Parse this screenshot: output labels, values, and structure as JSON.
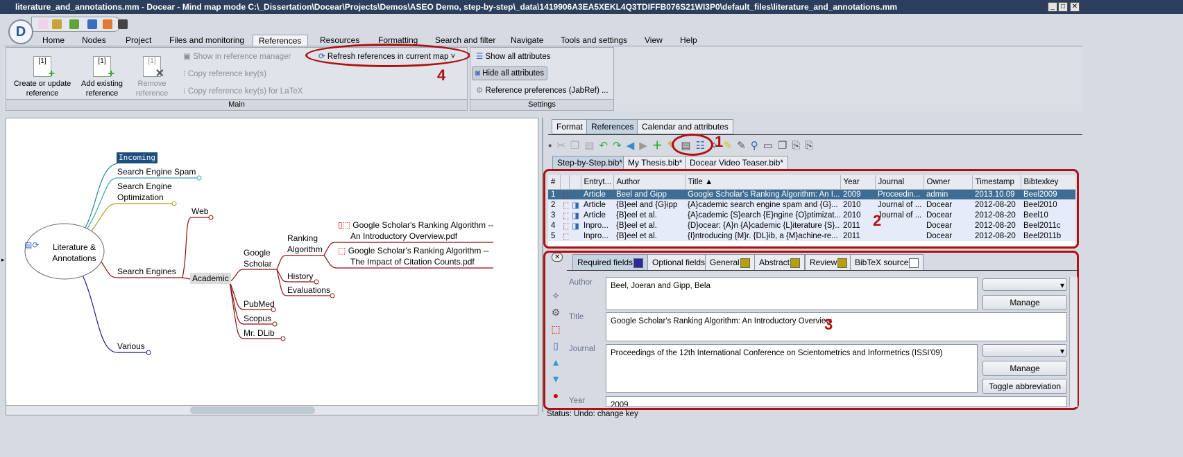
{
  "window": {
    "title": "literature_and_annotations.mm - Docear - Mind map mode C:\\_Dissertation\\Docear\\Projects\\Demos\\ASEO Demo, step-by-step\\_data\\1419906A3EA5XEKL4Q3TDIFFB076S21WI3P0\\default_files\\literature_and_annotations.mm",
    "controls": [
      "_",
      "□",
      "✕"
    ]
  },
  "menu": {
    "tabs": [
      "Home",
      "Nodes",
      "Project",
      "Files and monitoring",
      "References",
      "Resources",
      "Formatting",
      "Search and filter",
      "Navigate",
      "Tools and settings",
      "View",
      "Help"
    ],
    "active": "References"
  },
  "ribbon": {
    "main": {
      "label": "Main",
      "create": "Create or update reference",
      "add": "Add existing reference",
      "remove": "Remove reference",
      "show_in_manager": "Show in reference manager",
      "copy_keys": "Copy reference key(s)",
      "copy_keys_latex": "Copy reference key(s) for LaTeX",
      "refresh": "Refresh references in current map",
      "icon_text": "[1]"
    },
    "settings": {
      "label": "Settings",
      "show_all": "Show all attributes",
      "hide_all": "Hide all attributes",
      "prefs": "Reference preferences (JabRef) ..."
    }
  },
  "annotations": {
    "one": "1",
    "two": "2",
    "three": "3",
    "four": "4",
    "color": "#b01010"
  },
  "mindmap": {
    "root": "Literature & Annotations",
    "nodes": {
      "incoming": "Incoming",
      "spam": "Search Engine Spam",
      "seo1": "Search Engine",
      "seo2": "Optimization",
      "search_engines": "Search Engines",
      "web": "Web",
      "academic": "Academic",
      "gs1": "Google",
      "gs2": "Scholar",
      "ra1": "Ranking",
      "ra2": "Algorithm",
      "history": "History",
      "evaluations": "Evaluations",
      "pubmed": "PubMed",
      "scopus": "Scopus",
      "mrdlib": "Mr. DLib",
      "various": "Various",
      "pdf1a": "Google Scholar's Ranking Algorithm --",
      "pdf1b": "An Introductory Overview.pdf",
      "pdf2a": "Google Scholar's Ranking Algorithm --",
      "pdf2b": "The Impact of Citation Counts.pdf"
    }
  },
  "panel": {
    "tabs": [
      "Format",
      "References",
      "Calendar and attributes"
    ],
    "active_tab": "References",
    "bib_tabs": [
      "Step-by-Step.bib*",
      "My Thesis.bib*",
      "Docear Video Teaser.bib*"
    ],
    "table": {
      "columns": [
        "#",
        "",
        "",
        "Entryt...",
        "Author",
        "Title ▲",
        "Year",
        "Journal",
        "Owner",
        "Timestamp",
        "Bibtexkey"
      ],
      "rows": [
        [
          "1",
          "Article",
          "Beel and Gipp",
          "Google Scholar's Ranking Algorithm: An I...",
          "2009",
          "Proceedin...",
          "admin",
          "2013.10.09",
          "Beel2009"
        ],
        [
          "2",
          "Article",
          "{B}eel and {G}ipp",
          "{A}cademic search engine spam and {G}...",
          "2010",
          "Journal of ...",
          "Docear",
          "2012-08-20",
          "Beel2010"
        ],
        [
          "3",
          "Article",
          "{B}eel et al.",
          "{A}cademic {S}earch {E}ngine {O}ptimizat...",
          "2010",
          "Journal of ...",
          "Docear",
          "2012-08-20",
          "Beel10"
        ],
        [
          "4",
          "Inpro...",
          "{B}eel et al.",
          "{D}ocear: {A}n {A}cademic {L}iterature {S}...",
          "2011",
          "",
          "Docear",
          "2012-08-20",
          "Beel2011c"
        ],
        [
          "5",
          "Inpro...",
          "{B}eel et al.",
          "{I}ntroducing {M}r. {DL}ib, a {M}achine-re...",
          "2011",
          "",
          "Docear",
          "2012-08-20",
          "Beel2011b"
        ]
      ]
    },
    "editor_tabs": [
      {
        "label": "Required fields",
        "color": "#2a2a9a"
      },
      {
        "label": "Optional fields",
        "color": "#5aaa6a"
      },
      {
        "label": "General",
        "color": "#b8a000"
      },
      {
        "label": "Abstract",
        "color": "#b8a000"
      },
      {
        "label": "Review",
        "color": "#b8a000"
      },
      {
        "label": "BibTeX source",
        "color": "#ffffff"
      }
    ],
    "fields": {
      "author_label": "Author",
      "author": "Beel, Joeran and Gipp, Bela",
      "title_label": "Title",
      "title": "Google Scholar's Ranking Algorithm: An Introductory Overview",
      "journal_label": "Journal",
      "journal": "Proceedings of the 12th International Conference on Scientometrics and Informetrics (ISSI'09)",
      "year_label": "Year",
      "year": "2009"
    },
    "buttons": {
      "manage": "Manage",
      "toggle": "Toggle abbreviation"
    }
  },
  "status": "Status: Undo: change key"
}
